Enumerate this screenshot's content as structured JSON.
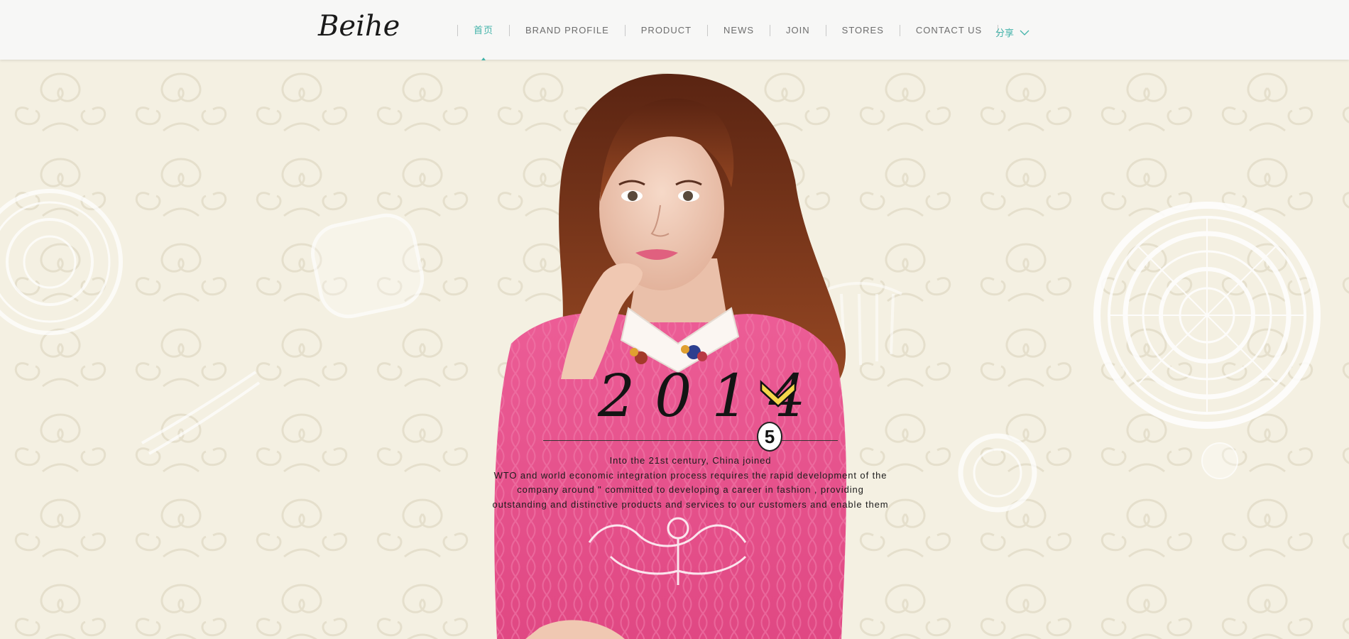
{
  "header": {
    "logo": "Beihe",
    "nav": [
      {
        "label": "首页",
        "active": true
      },
      {
        "label": "BRAND PROFILE",
        "active": false
      },
      {
        "label": "PRODUCT",
        "active": false
      },
      {
        "label": "NEWS",
        "active": false
      },
      {
        "label": "JOIN",
        "active": false
      },
      {
        "label": "STORES",
        "active": false
      },
      {
        "label": "CONTACT US",
        "active": false
      }
    ],
    "share_label": "分享",
    "share_icon": "chevron-down-icon"
  },
  "hero": {
    "year_text": "2014",
    "badge_number": "5",
    "copy_lines": [
      "Into the 21st century, China joined",
      "WTO and world economic integration process requires the rapid development of the",
      "company around \" committed to developing a career in fashion , providing",
      "outstanding and distinctive products and services to our customers and enable them"
    ]
  },
  "colors": {
    "accent": "#42b3a9",
    "background": "#f4f0e2",
    "sweater": "#e8558f",
    "hair": "#7a3518",
    "text": "#1c1c1c"
  }
}
